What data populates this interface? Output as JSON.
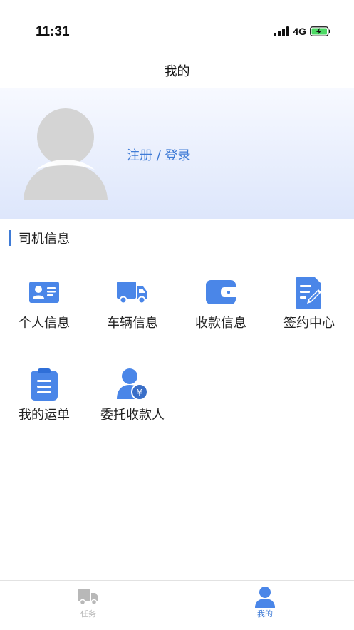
{
  "status_bar": {
    "time": "11:31",
    "network": "4G"
  },
  "nav": {
    "title": "我的"
  },
  "profile": {
    "login_text": "注册 / 登录"
  },
  "section": {
    "title": "司机信息",
    "items": [
      {
        "label": "个人信息",
        "icon": "id-card-icon"
      },
      {
        "label": "车辆信息",
        "icon": "truck-icon"
      },
      {
        "label": "收款信息",
        "icon": "wallet-icon"
      },
      {
        "label": "签约中心",
        "icon": "contract-sign-icon"
      },
      {
        "label": "我的运单",
        "icon": "clipboard-icon"
      },
      {
        "label": "委托收款人",
        "icon": "payee-user-icon"
      }
    ]
  },
  "tabbar": {
    "tabs": [
      {
        "label": "任务",
        "icon": "truck-icon"
      },
      {
        "label": "我的",
        "icon": "user-icon"
      }
    ]
  },
  "colors": {
    "accent": "#3f7bd6",
    "icon_blue": "#4a86e8",
    "tab_inactive": "#b8b8b8",
    "banner_bottom": "#dde6fb"
  }
}
